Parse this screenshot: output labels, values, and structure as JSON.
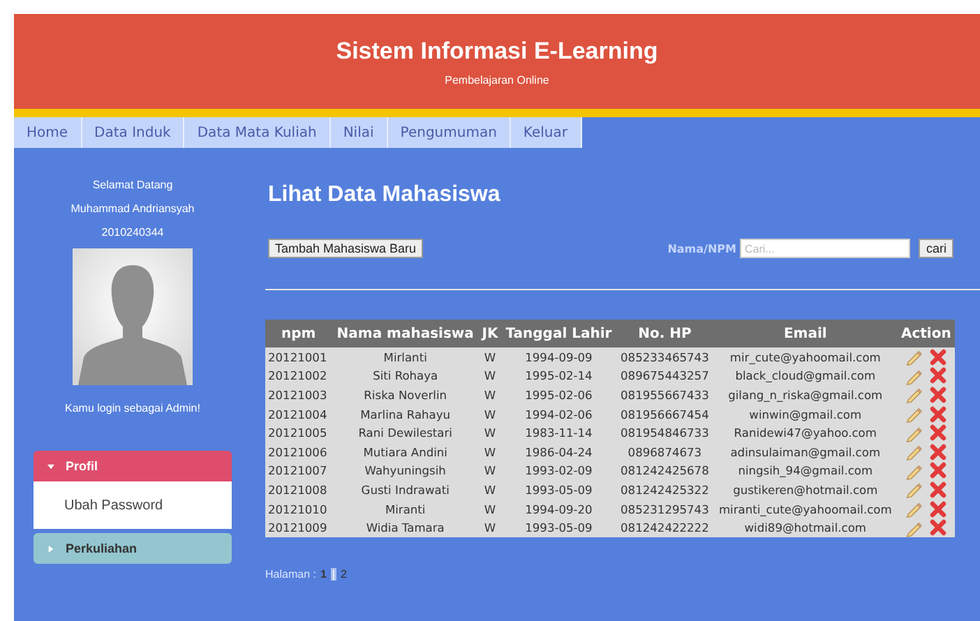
{
  "header": {
    "title": "Sistem Informasi E-Learning",
    "subtitle": "Pembelajaran Online"
  },
  "nav": [
    {
      "label": "Home"
    },
    {
      "label": "Data Induk"
    },
    {
      "label": "Data Mata Kuliah"
    },
    {
      "label": "Nilai"
    },
    {
      "label": "Pengumuman"
    },
    {
      "label": "Keluar"
    }
  ],
  "sidebar": {
    "greeting": "Selamat Datang",
    "user_name": "Muhammad Andriansyah",
    "user_id": "2010240344",
    "role_note": "Kamu login sebagai Admin!",
    "menu": [
      {
        "label": "Profil",
        "expanded": true,
        "children": [
          {
            "label": "Ubah Password"
          }
        ]
      },
      {
        "label": "Perkuliahan",
        "expanded": false
      }
    ]
  },
  "content": {
    "title": "Lihat Data Mahasiswa",
    "add_button": "Tambah Mahasiswa Baru",
    "search_label": "Nama/NPM",
    "search": {
      "placeholder": "Cari..."
    },
    "search_button": "cari",
    "table": {
      "columns": [
        "npm",
        "Nama mahasiswa",
        "JK",
        "Tanggal Lahir",
        "No. HP",
        "Email",
        "Action"
      ],
      "rows": [
        [
          "20121001",
          "Mirlanti",
          "W",
          "1994-09-09",
          "085233465743",
          "mir_cute@yahoomail.com"
        ],
        [
          "20121002",
          "Siti Rohaya",
          "W",
          "1995-02-14",
          "089675443257",
          "black_cloud@gmail.com"
        ],
        [
          "20121003",
          "Riska Noverlin",
          "W",
          "1995-02-06",
          "081955667433",
          "gilang_n_riska@gmail.com"
        ],
        [
          "20121004",
          "Marlina Rahayu",
          "W",
          "1994-02-06",
          "081956667454",
          "winwin@gmail.com"
        ],
        [
          "20121005",
          "Rani Dewilestari",
          "W",
          "1983-11-14",
          "081954846733",
          "Ranidewi47@yahoo.com"
        ],
        [
          "20121006",
          "Mutiara Andini",
          "W",
          "1986-04-24",
          "0896874673",
          "adinsulaiman@gmail.com"
        ],
        [
          "20121007",
          "Wahyuningsih",
          "W",
          "1993-02-09",
          "081242425678",
          "ningsih_94@gmail.com"
        ],
        [
          "20121008",
          "Gusti Indrawati",
          "W",
          "1993-05-09",
          "081242425322",
          "gustikeren@hotmail.com"
        ],
        [
          "20121010",
          "Miranti",
          "W",
          "1994-09-20",
          "085231295743",
          "miranti_cute@yahoomail.com"
        ],
        [
          "20121009",
          "Widia Tamara",
          "W",
          "1993-05-09",
          "081242422222",
          "widi89@hotmail.com"
        ]
      ]
    },
    "pagination": {
      "label": "Halaman :",
      "separator": "|",
      "pages": [
        {
          "label": "1",
          "selected": true
        },
        {
          "label": "2",
          "selected": false
        }
      ]
    }
  }
}
